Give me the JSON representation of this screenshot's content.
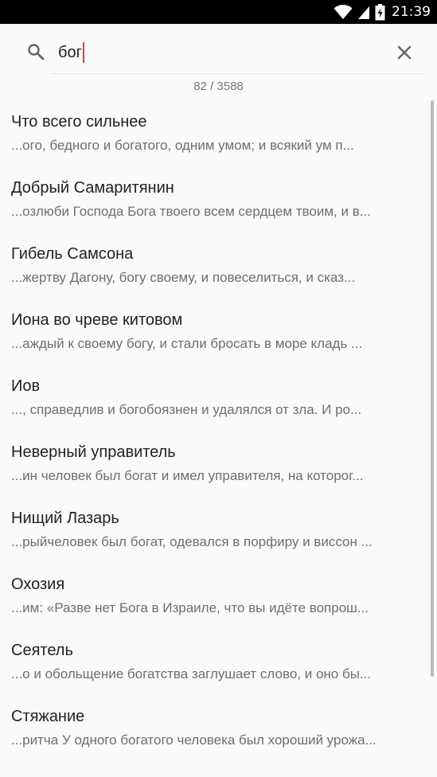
{
  "status_bar": {
    "time": "21:39",
    "icons": [
      "wifi-icon",
      "signal-icon",
      "battery-icon"
    ]
  },
  "search": {
    "value": "бог",
    "clear_icon": "close-icon",
    "search_icon": "search-icon"
  },
  "results_count": "82 / 3588",
  "results": [
    {
      "title": "Что всего сильнее",
      "snippet": "...ого, бедного и богатого, одним умом; и всякий ум п..."
    },
    {
      "title": "Добрый Самаритянин",
      "snippet": "...озлюби Господа Бога твоего всем сердцем твоим, и в..."
    },
    {
      "title": "Гибель Самсона",
      "snippet": "...жертву Дагону, богу своему, и повеселиться, и сказ..."
    },
    {
      "title": "Иона во чреве китовом",
      "snippet": "...аждый к своему богу, и стали бросать в море кладь ..."
    },
    {
      "title": "Иов",
      "snippet": "..., справедлив и богобоязнен и удалялся от зла. И ро..."
    },
    {
      "title": "Неверный управитель",
      "snippet": "...ин человек был богат и имел управителя, на которог..."
    },
    {
      "title": "Нищий Лазарь",
      "snippet": "...рыйчеловек был богат, одевался в порфиру и виссон ..."
    },
    {
      "title": "Охозия",
      "snippet": "...им: «Разве нет Бога в Израиле, что вы идёте вопрош..."
    },
    {
      "title": "Сеятель",
      "snippet": "...о и обольщение богатства заглушает слово, и оно бы..."
    },
    {
      "title": "Стяжание",
      "snippet": "...ритча У одного богатого человека был хороший урожа..."
    }
  ],
  "colors": {
    "accent_caret": "#e53935",
    "background": "#fafafa",
    "title_text": "#222222",
    "snippet_text": "#6e6e6e"
  }
}
